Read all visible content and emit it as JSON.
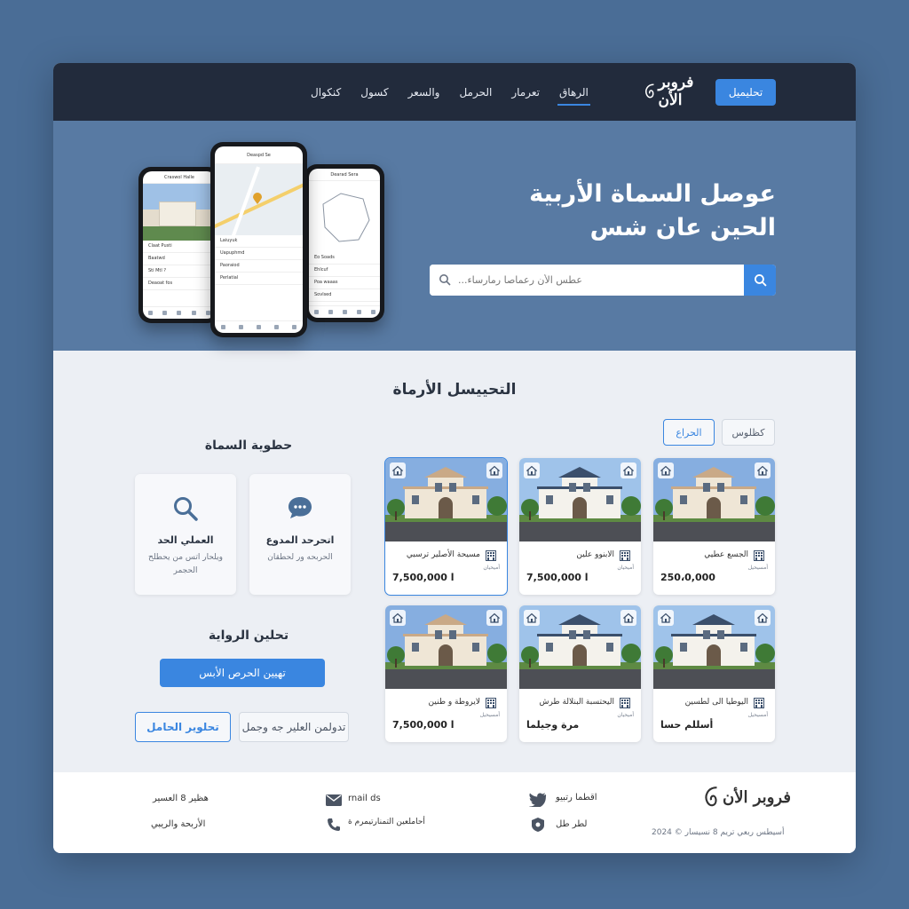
{
  "header": {
    "cta_label": "تحليميل",
    "brand_name": "فروبر الأن",
    "nav": [
      "الرهاق",
      "تعرمار",
      "الحرمل",
      "والسعر",
      "كسول",
      "كنكوال"
    ],
    "active_nav_index": 0
  },
  "hero": {
    "title": "عوصل السماة الأربية الحين عان شس",
    "search_placeholder": "...عطس الأن رعماصا رمارساء"
  },
  "phones": {
    "left": {
      "bar": "Craswol Halle",
      "rows": [
        "Claat Pusti",
        "Baatwd",
        "Sti Mtl ?",
        "Deaoat fos"
      ]
    },
    "center": {
      "bar": "Deaspd Se",
      "rows": [
        "Laiuyuk",
        "Uapuphmd",
        "Paoraiod",
        "Perlatial"
      ]
    },
    "right": {
      "bar": "Dearad Sera",
      "rows": [
        "Eo Soads",
        "Ehlcuf",
        "Poa waaas",
        "Sovlsed"
      ]
    }
  },
  "main": {
    "section_title": "التحييسل الأرماة",
    "filters": [
      "كظلوس",
      "الحراع"
    ],
    "side_title_1": "حطوية السماة",
    "features": [
      {
        "icon": "chat-icon",
        "title": "اتحرحد المدوع",
        "desc": "الحربحه ور لحطقان"
      },
      {
        "icon": "search-icon",
        "title": "العملي الحد",
        "desc": "ويلحار اتس من يحطلح الحجمر"
      }
    ],
    "side_title_2": "تحلين الرواية",
    "primary_button": "تهيين الحرص الأبس",
    "outline_button_blue": "تحلوير الحامل",
    "outline_button_grey": "تدولمن العلير جه وجمل"
  },
  "cards": [
    {
      "title": "الجسع عطيي",
      "subtitle": "أمسيحيل",
      "price": "250،0,000",
      "variant": "a"
    },
    {
      "title": "الابنوو علين",
      "subtitle": "أميحيان",
      "price": "7,500,000 ا",
      "variant": "b"
    },
    {
      "title": "مسيحة الأصلير ترسبي",
      "subtitle": "أميحيان",
      "price": "7,500,000 ا",
      "variant": "a",
      "selected": true
    },
    {
      "title": "اليوطيا الى لطسين",
      "subtitle": "أمسيحيل",
      "price": "أسللم حسا",
      "variant": "b"
    },
    {
      "title": "اليحتسبة البنلالة طرش",
      "subtitle": "أميحيان",
      "price": "مرة وجيلما",
      "variant": "b"
    },
    {
      "title": "لايروطة و طنين",
      "subtitle": "أمسيحيل",
      "price": "7,500,000 ا",
      "variant": "a"
    }
  ],
  "footer": {
    "brand_name": "فروبر الأن",
    "copyright": "2024 © أسيطس ربعي تريم 8 نسيسار",
    "social": [
      "اقطما رتبيو",
      "لطر طل"
    ],
    "contact": [
      "rnail ds",
      "أحاملعين التمنارتيمرم ة"
    ],
    "links": [
      "هظير 8 العسير",
      "الأربحة والريبي"
    ]
  },
  "colors": {
    "accent": "#3a86e0",
    "header_bg": "#222b3c",
    "hero_bg": "#587aa3",
    "page_bg": "#4a6d96"
  }
}
